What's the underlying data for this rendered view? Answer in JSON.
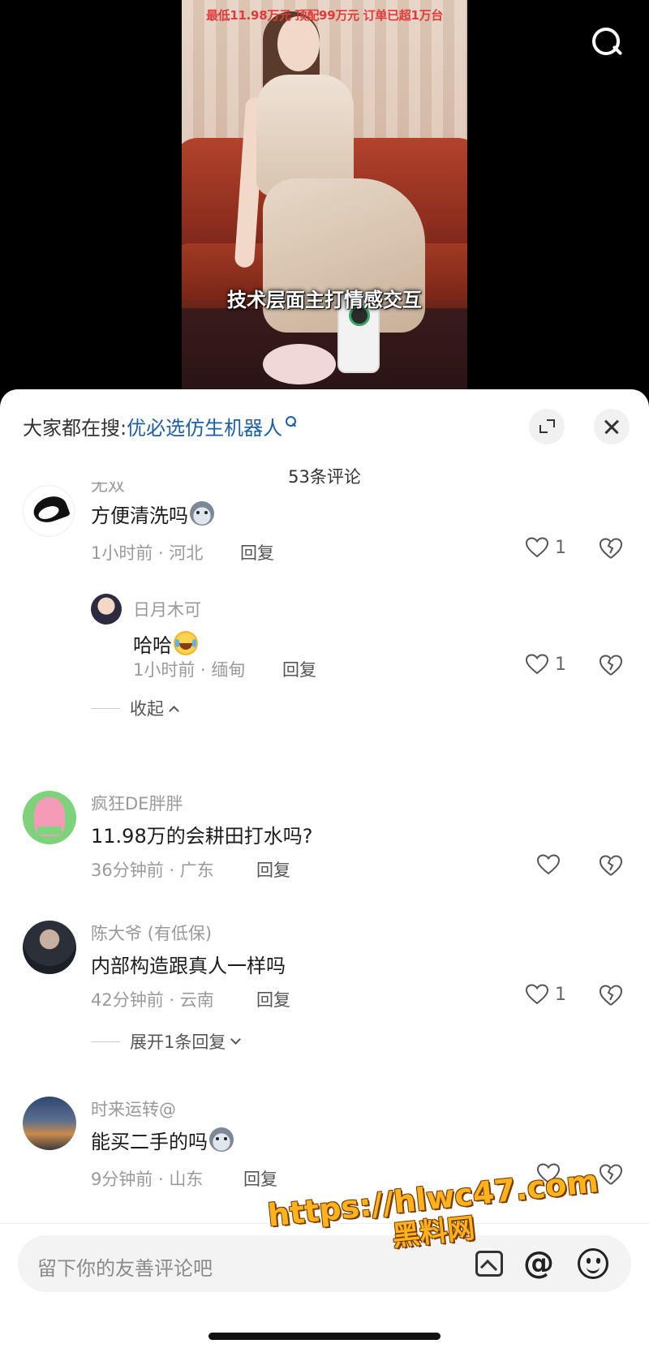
{
  "video": {
    "top_text": "最低11.98万元  顶配99万元  订单已超1万台",
    "caption": "技术层面主打情感交互"
  },
  "panel": {
    "trending_prefix": "大家都在搜:",
    "trending_link": "优必选仿生机器人",
    "comment_count": "53条评论"
  },
  "comments": [
    {
      "username": "无双",
      "text": "方便清洗吗",
      "meta": "1小时前 · 河北",
      "reply": "回复",
      "likes": "1",
      "replies": [
        {
          "username": "日月木可",
          "text": "哈哈",
          "meta": "1小时前 · 缅甸",
          "reply": "回复",
          "likes": "1"
        }
      ],
      "collapse_label": "收起"
    },
    {
      "username": "疯狂DE胖胖",
      "text": "11.98万的会耕田打水吗?",
      "meta": "36分钟前 · 广东",
      "reply": "回复",
      "likes": ""
    },
    {
      "username": "陈大爷 (有低保)",
      "text": "内部构造跟真人一样吗",
      "meta": "42分钟前 · 云南",
      "reply": "回复",
      "likes": "1",
      "expand_label": "展开1条回复"
    },
    {
      "username": "时来运转@",
      "text": "能买二手的吗",
      "meta": "9分钟前 · 山东",
      "reply": "回复",
      "likes": ""
    }
  ],
  "input": {
    "placeholder": "留下你的友善评论吧"
  },
  "watermark": {
    "line1": "https://hlwc47.com",
    "line2": "黑料网"
  },
  "icons": [
    "search-icon",
    "expand-icon",
    "close-icon",
    "heart-icon",
    "dislike-icon",
    "image-icon",
    "at-icon",
    "emoji-icon"
  ],
  "colors": {
    "link_blue": "#1e5fa8",
    "video_top_text_red": "#e23a3a",
    "watermark_orange": "#ffb31a"
  }
}
